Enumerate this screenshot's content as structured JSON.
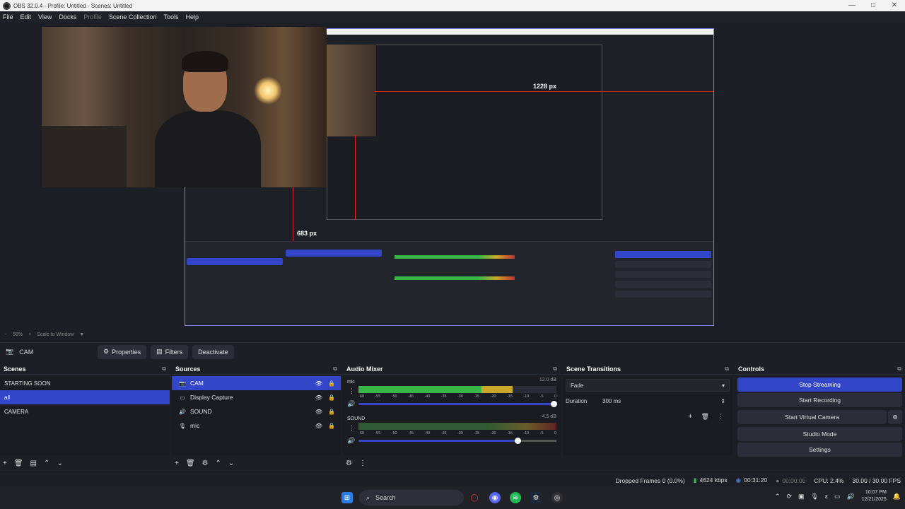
{
  "window": {
    "title": "OBS 32.0.4 - Profile: Untitled - Scenes: Untitled",
    "controls": [
      "—",
      "□",
      "✕"
    ]
  },
  "menu": [
    "File",
    "Edit",
    "View",
    "Docks",
    "Profile",
    "Scene Collection",
    "Tools",
    "Help"
  ],
  "preview": {
    "measure_h": "1228 px",
    "measure_v": "683 px",
    "inner_measure_h": "1228 px"
  },
  "zoombar": {
    "zoom_minus": "−",
    "zoom": "58%",
    "zoom_plus": "+",
    "scale": "Scale to Window"
  },
  "source_toolbar": {
    "current": "CAM",
    "properties": "Properties",
    "filters": "Filters",
    "deactivate": "Deactivate"
  },
  "scenes": {
    "title": "Scenes",
    "items": [
      {
        "label": "STARTING SOON",
        "selected": false
      },
      {
        "label": "all",
        "selected": true
      },
      {
        "label": "CAMERA",
        "selected": false
      }
    ]
  },
  "sources": {
    "title": "Sources",
    "items": [
      {
        "label": "CAM",
        "icon": "camera-icon",
        "selected": true
      },
      {
        "label": "Display Capture",
        "icon": "monitor-icon",
        "selected": false
      },
      {
        "label": "SOUND",
        "icon": "speaker-icon",
        "selected": false
      },
      {
        "label": "mic",
        "icon": "microphone-icon",
        "selected": false
      }
    ]
  },
  "mixer": {
    "title": "Audio Mixer",
    "ticks": [
      "-60",
      "-55",
      "-50",
      "-45",
      "-40",
      "-35",
      "-30",
      "-25",
      "-20",
      "-15",
      "-10",
      "-5",
      "0"
    ],
    "channels": [
      {
        "name": "mic",
        "db": "12.0 dB",
        "level": 0.78,
        "volume": 0.98
      },
      {
        "name": "SOUND",
        "db": "-4.5 dB",
        "level": 0.0,
        "volume": 0.8
      }
    ]
  },
  "transitions": {
    "title": "Scene Transitions",
    "type": "Fade",
    "duration_label": "Duration",
    "duration": "300 ms"
  },
  "controls": {
    "title": "Controls",
    "stop_streaming": "Stop Streaming",
    "start_recording": "Start Recording",
    "start_virtual_camera": "Start Virtual Camera",
    "studio_mode": "Studio Mode",
    "settings": "Settings"
  },
  "status": {
    "dropped": "Dropped Frames 0 (0.0%)",
    "bitrate": "4624 kbps",
    "stream_time": "00:31:20",
    "rec_time": "00:00:00",
    "cpu": "CPU: 2.4%",
    "fps": "30.00 / 30.00 FPS"
  },
  "taskbar": {
    "search": "Search",
    "time": "10:07 PM",
    "date": "12/21/2025"
  },
  "colors": {
    "accent": "#3346c9",
    "bg": "#1d1f26",
    "measure": "#e02020"
  }
}
